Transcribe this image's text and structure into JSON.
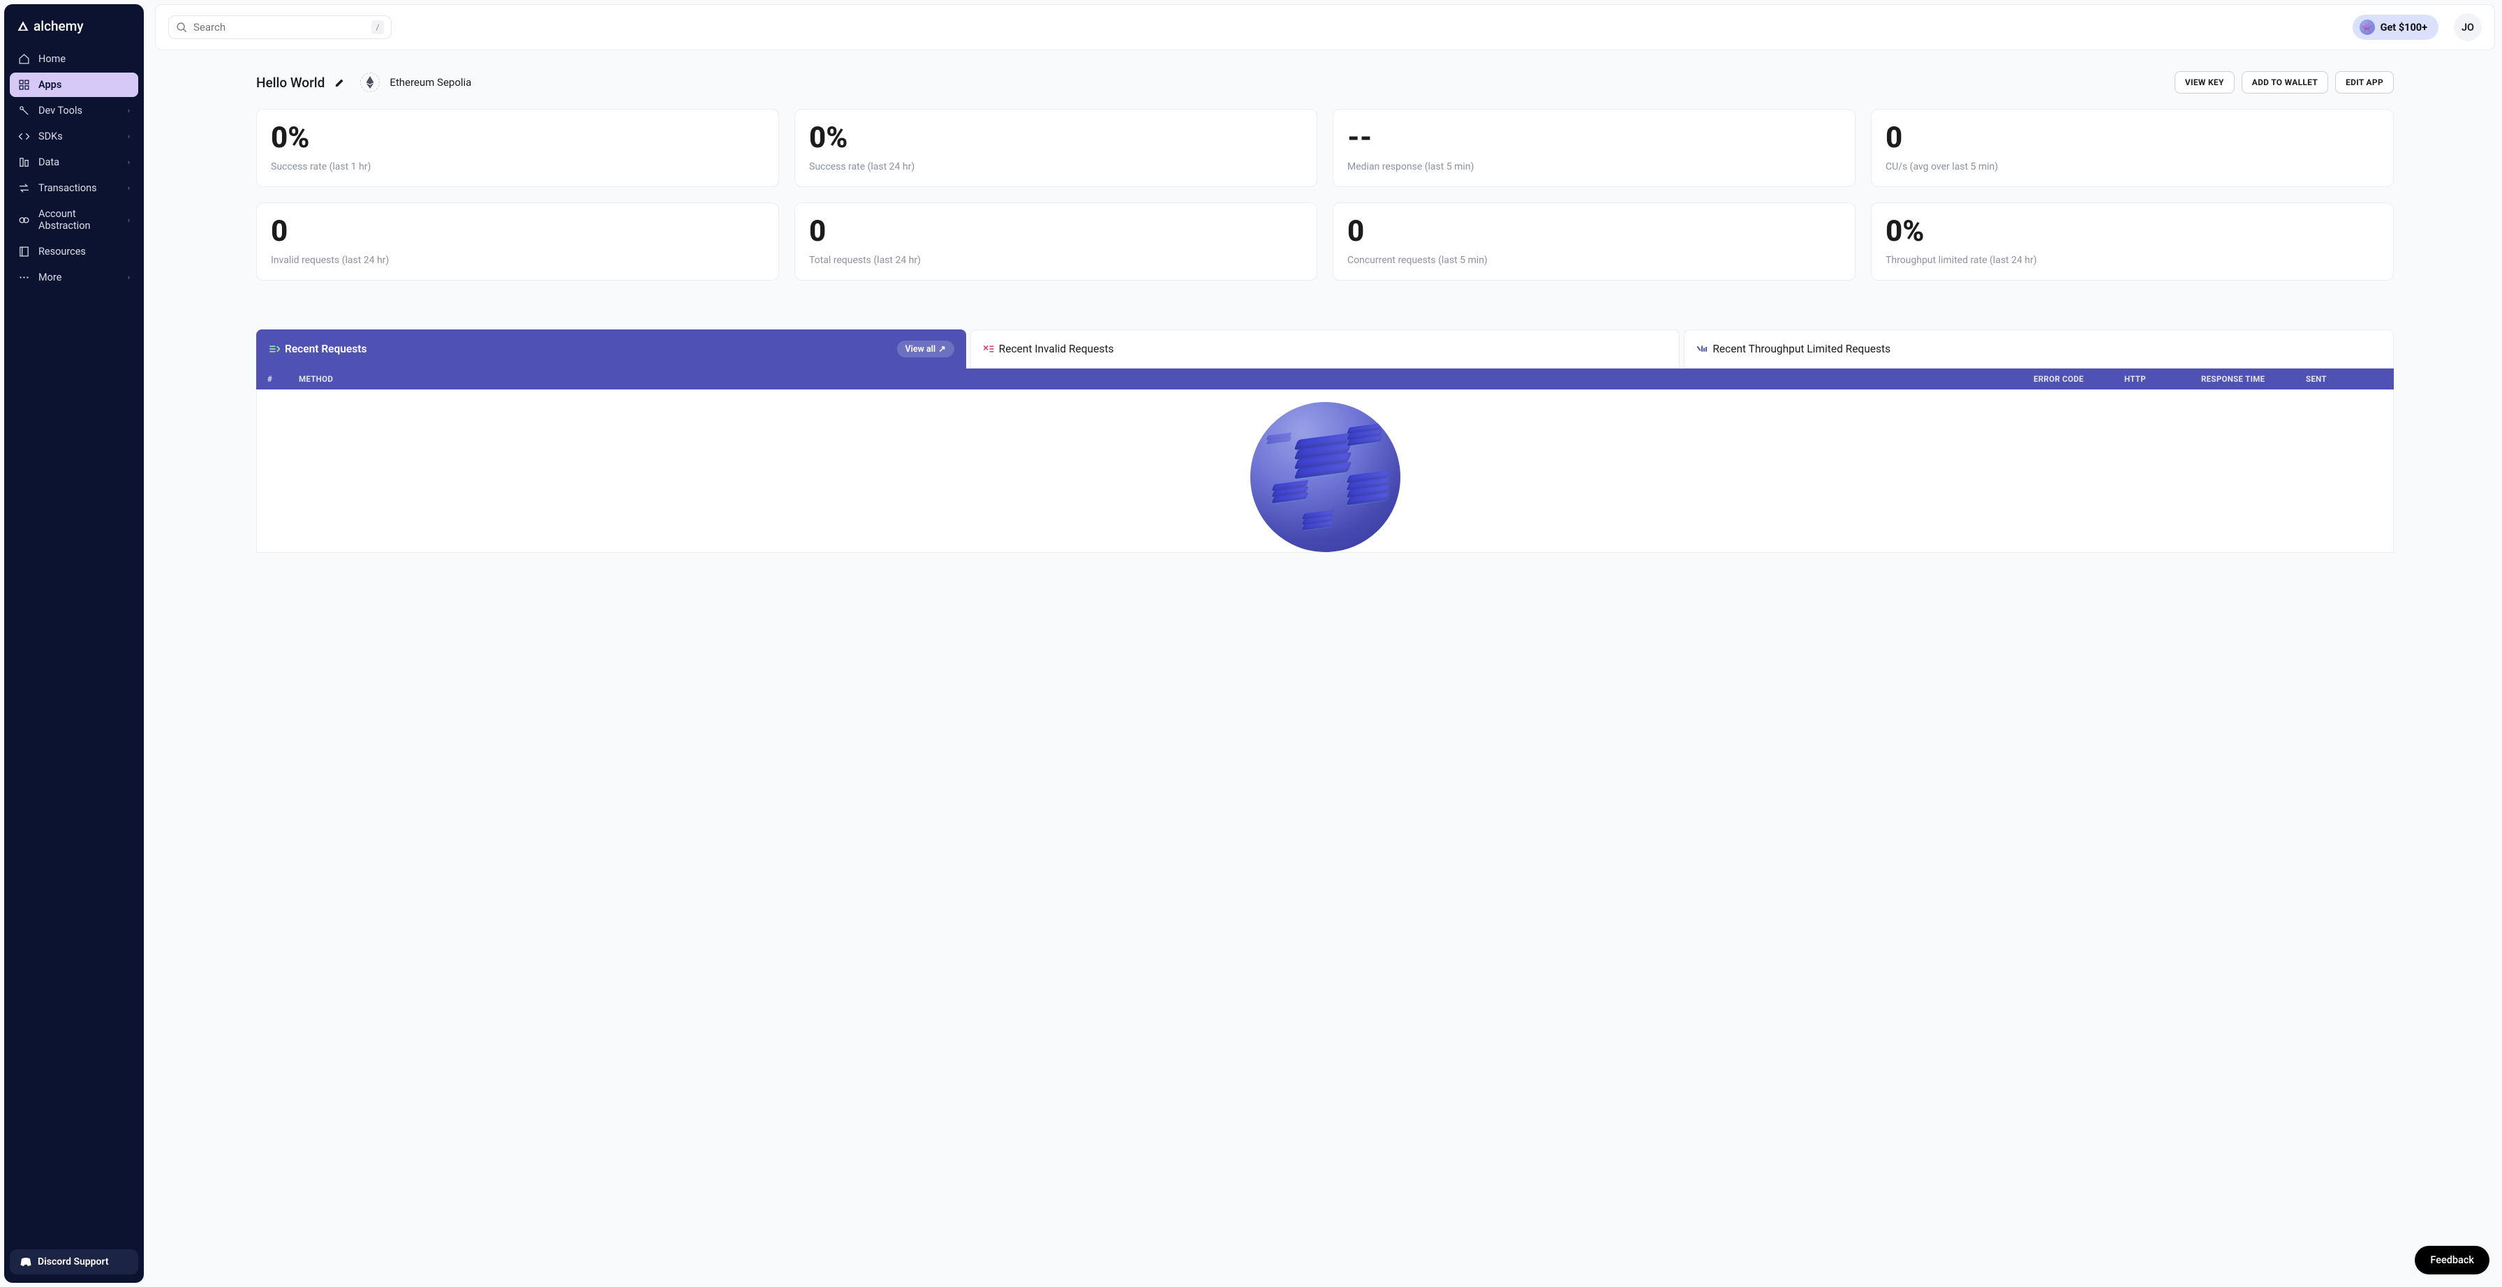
{
  "brand": "alchemy",
  "search": {
    "placeholder": "Search",
    "slash": "/"
  },
  "reward": {
    "label": "Get $100+"
  },
  "user": {
    "initials": "JO"
  },
  "sidebar": {
    "items": [
      {
        "label": "Home"
      },
      {
        "label": "Apps"
      },
      {
        "label": "Dev Tools"
      },
      {
        "label": "SDKs"
      },
      {
        "label": "Data"
      },
      {
        "label": "Transactions"
      },
      {
        "label": "Account Abstraction"
      },
      {
        "label": "Resources"
      },
      {
        "label": "More"
      }
    ],
    "discord": "Discord Support"
  },
  "app": {
    "name": "Hello World",
    "network": "Ethereum Sepolia",
    "buttons": {
      "view_key": "VIEW KEY",
      "add_wallet": "ADD TO WALLET",
      "edit": "EDIT APP"
    }
  },
  "stats": [
    {
      "value": "0%",
      "label": "Success rate (last 1 hr)"
    },
    {
      "value": "0%",
      "label": "Success rate (last 24 hr)"
    },
    {
      "value": "--",
      "label": "Median response (last 5 min)"
    },
    {
      "value": "0",
      "label": "CU/s (avg over last 5 min)"
    },
    {
      "value": "0",
      "label": "Invalid requests (last 24 hr)"
    },
    {
      "value": "0",
      "label": "Total requests (last 24 hr)"
    },
    {
      "value": "0",
      "label": "Concurrent requests (last 5 min)"
    },
    {
      "value": "0%",
      "label": "Throughput limited rate (last 24 hr)"
    }
  ],
  "tabs": {
    "recent": "Recent Requests",
    "view_all": "View all",
    "invalid": "Recent Invalid Requests",
    "throughput": "Recent Throughput Limited Requests"
  },
  "table": {
    "cols": {
      "num": "#",
      "method": "METHOD",
      "error": "ERROR CODE",
      "http": "HTTP",
      "resp": "RESPONSE TIME",
      "sent": "SENT"
    }
  },
  "feedback": "Feedback"
}
